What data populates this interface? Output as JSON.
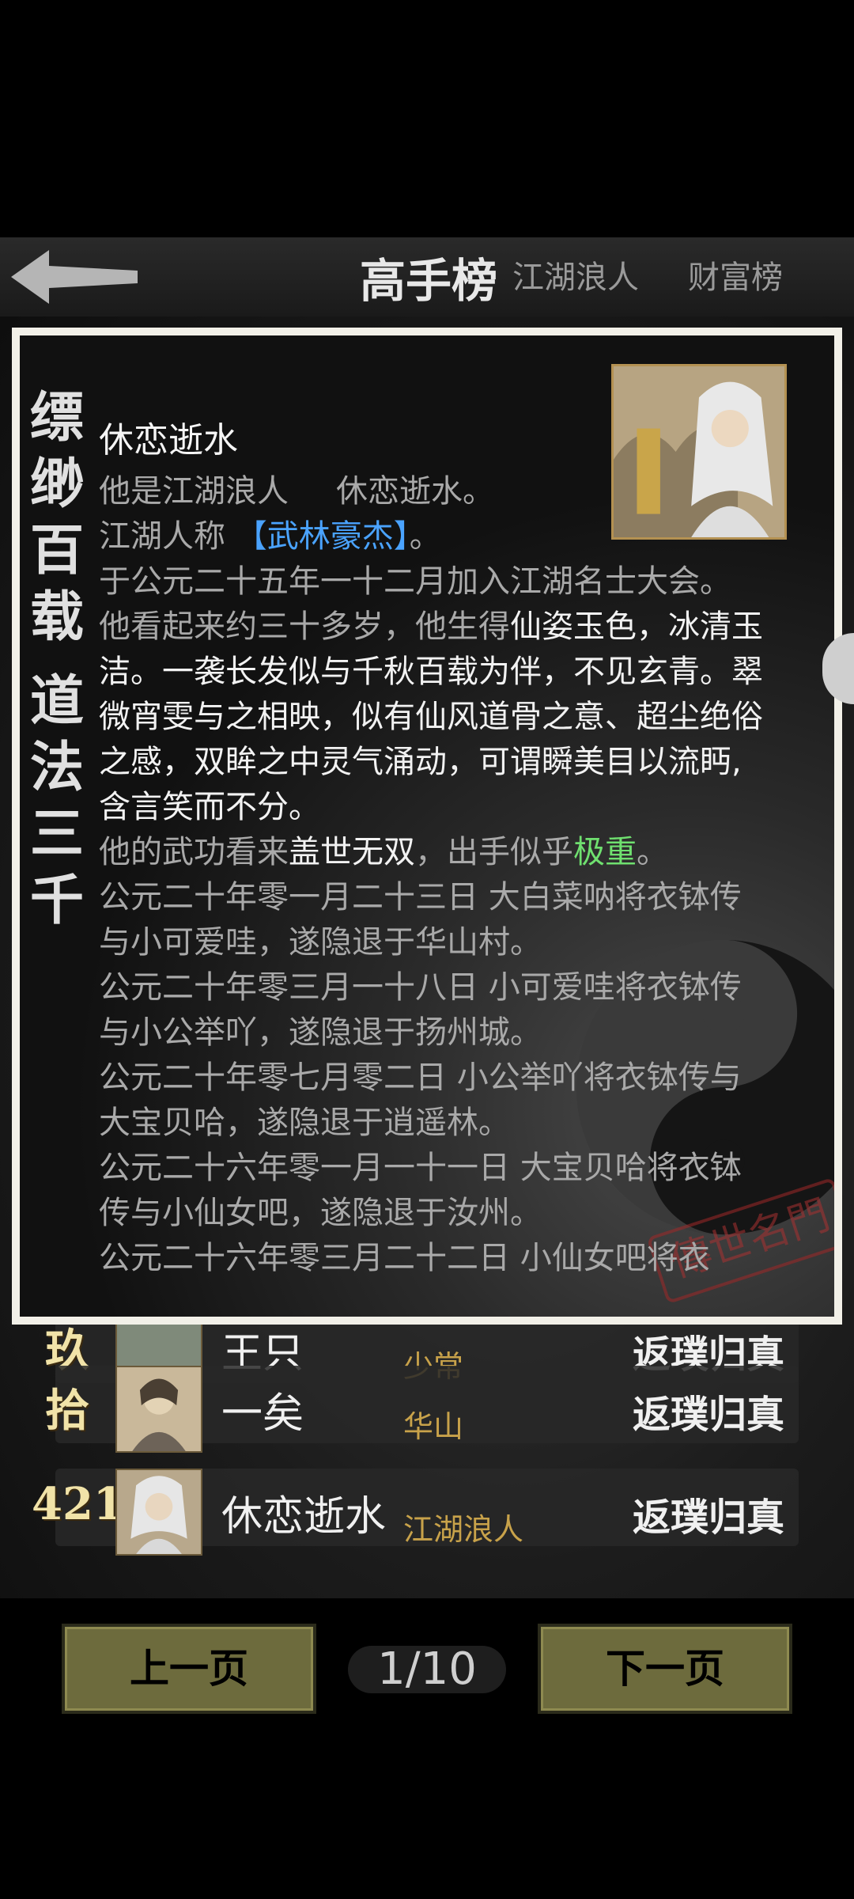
{
  "header": {
    "tabs": [
      {
        "label": "高手榜",
        "active": true
      },
      {
        "label": "江湖浪人",
        "active": false
      },
      {
        "label": "财富榜",
        "active": false
      }
    ],
    "back_icon": "left-arrow-icon"
  },
  "popup": {
    "calligraphy": [
      "缥",
      "缈",
      "百",
      "载",
      "道",
      "法",
      "三",
      "千"
    ],
    "name": "休恋逝水",
    "line1_a": "他是江湖浪人",
    "line1_b": "休恋逝水。",
    "line2_a": "江湖人称",
    "line2_title": "【武林豪杰】",
    "line2_b": "。",
    "line3": "于公元二十五年一十二月加入江湖名士大会。",
    "desc_a": "他看起来约三十多岁，他生得",
    "desc_hl": "仙姿玉色，冰清玉洁。一袭长发似与千秋百载为伴，不见玄青。翠微宵雯与之相映，似有仙风道骨之意、超尘绝俗之感，双眸之中灵气涌动，可谓瞬美目以流眄,含言笑而不分。",
    "kungfu_a": "他的武功看来",
    "kungfu_b": "盖世无双",
    "kungfu_c": "，出手似乎",
    "kungfu_d": "极重",
    "kungfu_e": "。",
    "history": [
      "公元二十年零一月二十三日 大白菜呐将衣钵传与小可爱哇，遂隐退于华山村。",
      "公元二十年零三月一十八日 小可爱哇将衣钵传与小公举吖，遂隐退于扬州城。",
      "公元二十年零七月零二日 小公举吖将衣钵传与大宝贝哈，遂隐退于逍遥林。",
      "公元二十六年零一月一十一日 大宝贝哈将衣钵传与小仙女吧，遂隐退于汝州。",
      "公元二十六年零三月二十二日 小仙女吧将衣"
    ],
    "seal_text": "傳世名門"
  },
  "list": {
    "rows": [
      {
        "rank": "玖",
        "name": "王只",
        "sect": "少常",
        "level": "返璞归真"
      },
      {
        "rank": "拾",
        "name": "一矣",
        "sect": "华山",
        "level": "返璞归真"
      },
      {
        "rank": "421",
        "name": "休恋逝水",
        "sect": "江湖浪人",
        "level": "返璞归真"
      }
    ]
  },
  "footer": {
    "prev_label": "上一页",
    "next_label": "下一页",
    "page": "1/10"
  },
  "colors": {
    "button_bg": "#6d6b3d",
    "sect_gold": "#c8a24a",
    "title_blue": "#4aa3ff",
    "highlight_green": "#6fe06f"
  }
}
